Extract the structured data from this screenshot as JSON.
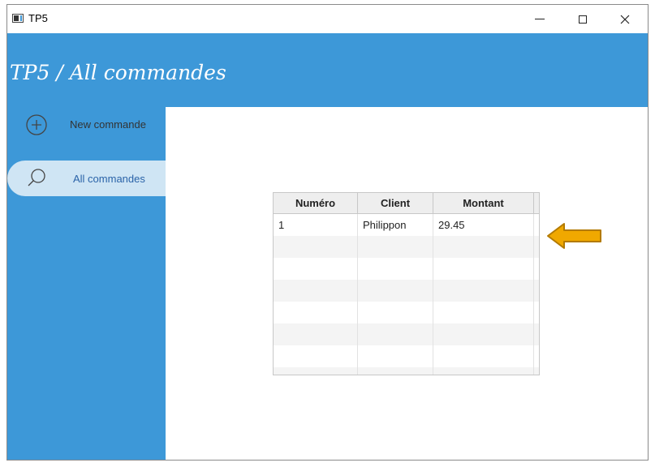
{
  "window": {
    "title": "TP5"
  },
  "header": {
    "title": "TP5 / All commandes"
  },
  "sidebar": {
    "items": [
      {
        "label": "New commande",
        "icon": "plus-circle-icon",
        "active": false
      },
      {
        "label": "All commandes",
        "icon": "search-icon",
        "active": true
      }
    ]
  },
  "table": {
    "columns": [
      "Numéro",
      "Client",
      "Montant"
    ],
    "rows": [
      {
        "numero": "1",
        "client": "Philippon",
        "montant": "29.45"
      }
    ]
  },
  "colors": {
    "accent": "#3d98d8",
    "active_item_bg": "#cfe5f4",
    "arrow": "#f0a800"
  }
}
